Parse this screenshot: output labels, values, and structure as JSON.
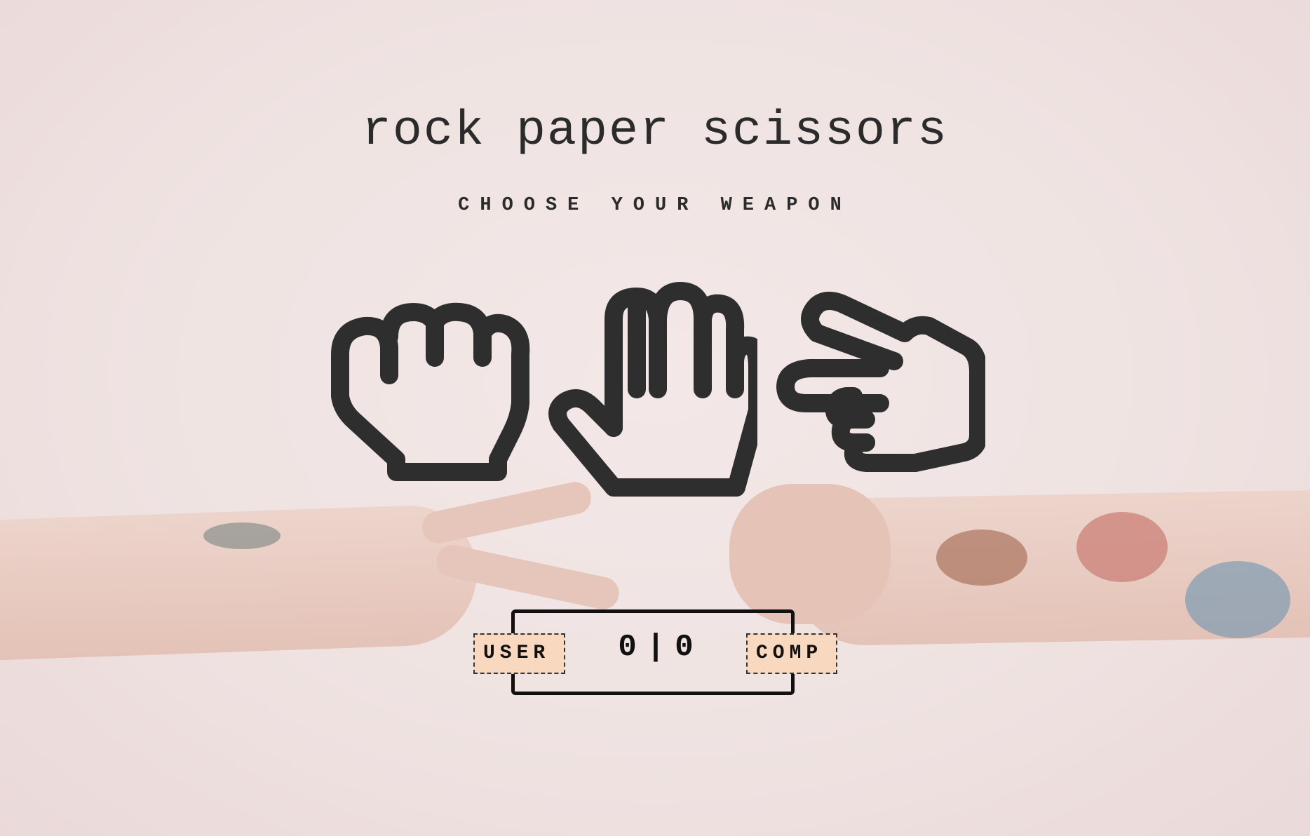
{
  "title": "rock paper scissors",
  "subtitle": "CHOOSE YOUR WEAPON",
  "choices": [
    {
      "name": "rock",
      "icon": "fist-icon"
    },
    {
      "name": "paper",
      "icon": "open-hand-icon"
    },
    {
      "name": "scissors",
      "icon": "scissors-hand-icon"
    }
  ],
  "scoreboard": {
    "user_label": "USER",
    "comp_label": "COMP",
    "user_score": "0",
    "separator": "|",
    "comp_score": "0"
  },
  "colors": {
    "background": "#efe2e1",
    "ink": "#2c2c2c",
    "badge": "#f8d8bf"
  }
}
